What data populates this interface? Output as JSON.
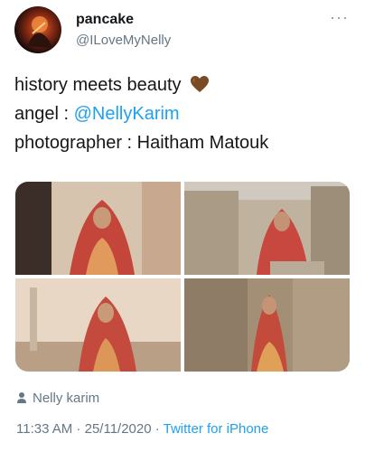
{
  "tweet": {
    "display_name": "pancake",
    "handle": "@ILoveMyNelly",
    "more_icon": "more-horizontal-icon",
    "lines": {
      "line1": "history meets beauty",
      "line2_prefix": "angel : ",
      "line2_mention": "@NellyKarim",
      "line3": "photographer : Haitham Matouk"
    },
    "emoji": "brown-heart",
    "mention_color": "#1da1f2",
    "photos": [
      {
        "name": "photo-1"
      },
      {
        "name": "photo-2"
      },
      {
        "name": "photo-3"
      },
      {
        "name": "photo-4"
      }
    ],
    "location": {
      "icon": "person-pin-icon",
      "label": "Nelly karim"
    },
    "meta": {
      "time": "11:33 AM",
      "separator1": " · ",
      "date": "25/11/2020",
      "separator2": " · ",
      "source": "Twitter for iPhone"
    }
  }
}
